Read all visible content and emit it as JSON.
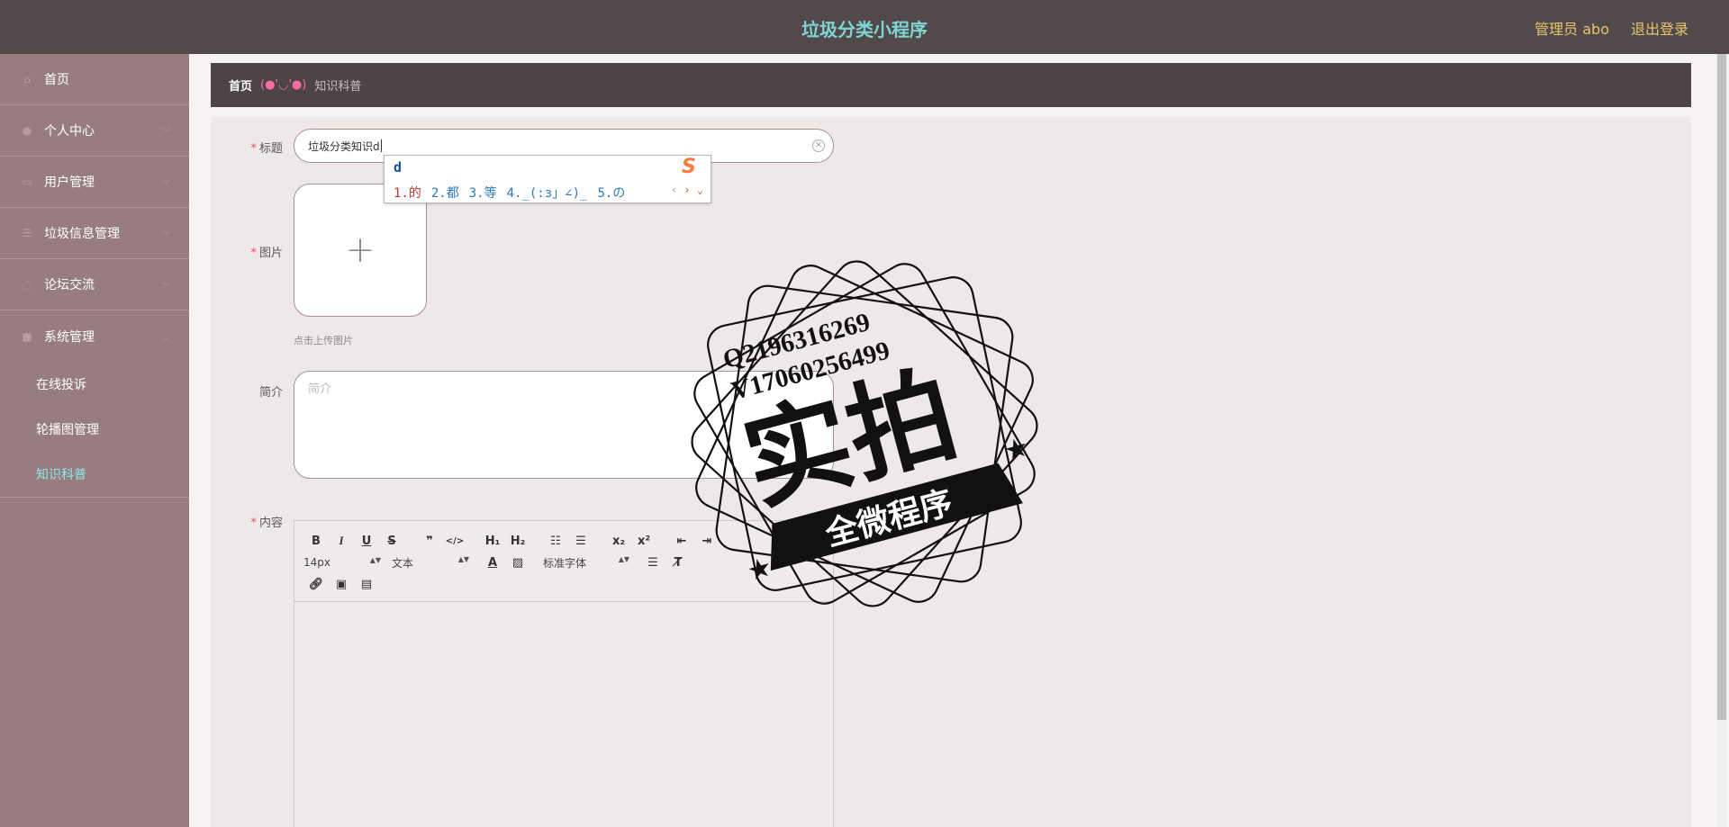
{
  "header": {
    "title": "垃圾分类小程序",
    "user_label": "管理员 abo",
    "logout_label": "退出登录"
  },
  "sidebar": {
    "items": [
      {
        "label": "首页"
      },
      {
        "label": "个人中心"
      },
      {
        "label": "用户管理"
      },
      {
        "label": "垃圾信息管理"
      },
      {
        "label": "论坛交流"
      },
      {
        "label": "系统管理"
      }
    ],
    "sub_items": [
      {
        "label": "在线投诉"
      },
      {
        "label": "轮播图管理"
      },
      {
        "label": "知识科普"
      }
    ]
  },
  "breadcrumb": {
    "home": "首页",
    "separator": "(●'◡'●)",
    "current": "知识科普"
  },
  "form": {
    "title_label": "标题",
    "title_value": "垃圾分类知识d",
    "image_label": "图片",
    "upload_tip": "点击上传图片",
    "intro_label": "简介",
    "intro_placeholder": "简介",
    "content_label": "内容",
    "required_mark": "*"
  },
  "editor": {
    "font_size": "14px",
    "paragraph": "文本",
    "font_family": "标准字体"
  },
  "ime": {
    "input": "d",
    "candidates": [
      "1.的",
      "2.都",
      "3.等",
      "4._(:з」∠)_",
      "5.の"
    ],
    "logo": "S"
  },
  "watermark": {
    "line1": "Q2196316269",
    "line2": "V17060256499",
    "big": "实拍",
    "banner": "全微程序"
  },
  "colors": {
    "header_bg": "#524a4a",
    "title": "#7fd3d3",
    "header_links": "#e7c66d",
    "sidebar_bg": "#987d80",
    "active_menu": "#8ee6e8"
  }
}
